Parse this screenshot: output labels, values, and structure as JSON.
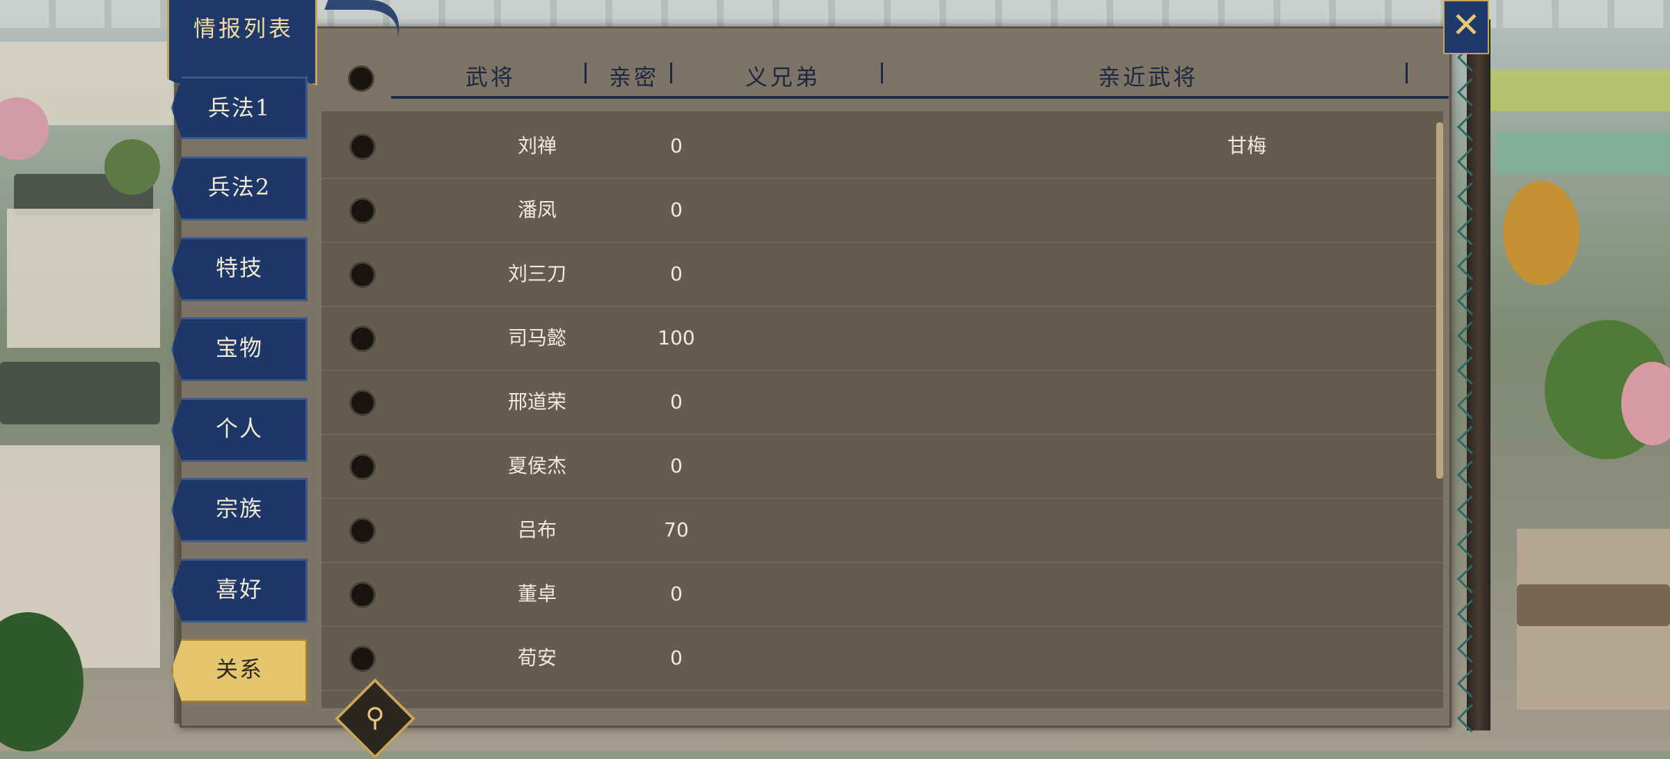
{
  "title": "情报列表",
  "close_icon": "close-x-icon",
  "tabs": [
    {
      "label": "兵法1",
      "active": false
    },
    {
      "label": "兵法2",
      "active": false
    },
    {
      "label": "特技",
      "active": false
    },
    {
      "label": "宝物",
      "active": false
    },
    {
      "label": "个人",
      "active": false
    },
    {
      "label": "宗族",
      "active": false
    },
    {
      "label": "喜好",
      "active": false
    },
    {
      "label": "关系",
      "active": true
    }
  ],
  "columns": [
    "武将",
    "亲密",
    "义兄弟",
    "亲近武将"
  ],
  "rows": [
    {
      "name": "刘禅",
      "intimacy": "0",
      "brothers": "",
      "close": "甘梅"
    },
    {
      "name": "潘凤",
      "intimacy": "0",
      "brothers": "",
      "close": ""
    },
    {
      "name": "刘三刀",
      "intimacy": "0",
      "brothers": "",
      "close": ""
    },
    {
      "name": "司马懿",
      "intimacy": "100",
      "brothers": "",
      "close": ""
    },
    {
      "name": "邢道荣",
      "intimacy": "0",
      "brothers": "",
      "close": ""
    },
    {
      "name": "夏侯杰",
      "intimacy": "0",
      "brothers": "",
      "close": ""
    },
    {
      "name": "吕布",
      "intimacy": "70",
      "brothers": "",
      "close": ""
    },
    {
      "name": "董卓",
      "intimacy": "0",
      "brothers": "",
      "close": ""
    },
    {
      "name": "荀安",
      "intimacy": "0",
      "brothers": "",
      "close": ""
    }
  ],
  "search_icon": "magnifier-icon",
  "colors": {
    "accent_gold": "#e5c66e",
    "tab_blue": "#1d3868",
    "text_light": "#f2ebdc"
  }
}
